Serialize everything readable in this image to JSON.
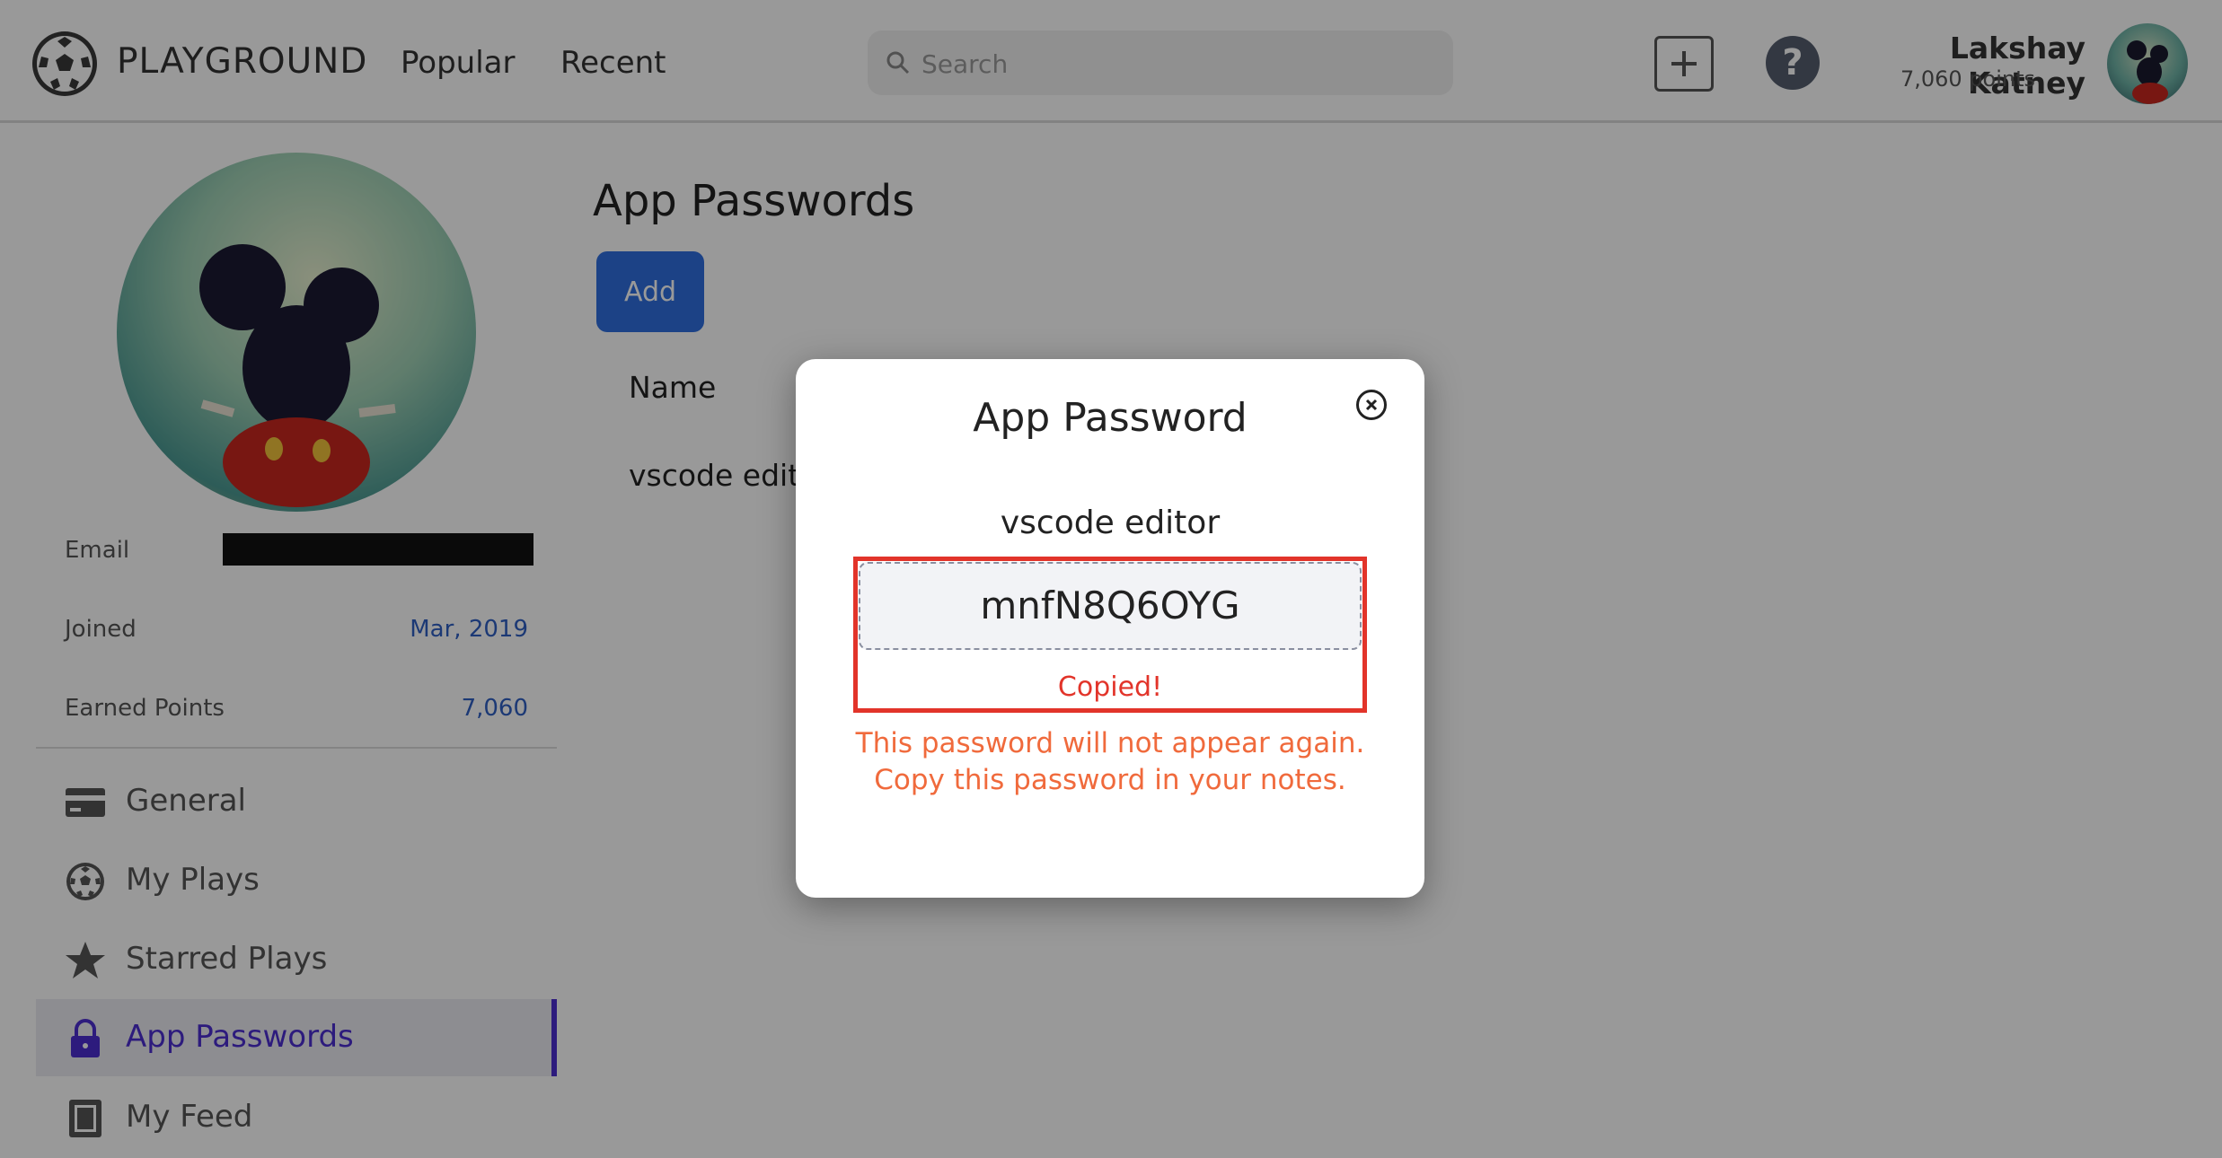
{
  "header": {
    "brand": "PLAYGROUND",
    "nav": [
      "Popular",
      "Recent"
    ],
    "search_placeholder": "Search",
    "help_glyph": "?",
    "user_name": "Lakshay Katney",
    "user_points": "7,060 points"
  },
  "profile": {
    "email_label": "Email",
    "joined_label": "Joined",
    "joined_value": "Mar, 2019",
    "points_label": "Earned Points",
    "points_value": "7,060"
  },
  "sidebar": {
    "items": [
      {
        "label": "General",
        "icon": "card-icon"
      },
      {
        "label": "My Plays",
        "icon": "soccer-ball-icon"
      },
      {
        "label": "Starred Plays",
        "icon": "star-icon"
      },
      {
        "label": "App Passwords",
        "icon": "lock-icon",
        "active": true
      },
      {
        "label": "My Feed",
        "icon": "feed-icon"
      }
    ]
  },
  "main": {
    "title": "App Passwords",
    "add_label": "Add",
    "column_name": "Name",
    "row_name": "vscode editor"
  },
  "modal": {
    "title": "App Password",
    "subtitle": "vscode editor",
    "password": "mnfN8Q6OYG",
    "copied": "Copied!",
    "warning_line1": "This password will not appear again.",
    "warning_line2": "Copy this password in your notes."
  },
  "colors": {
    "accent": "#4b2ed0",
    "primary_button": "#2f6fe0",
    "highlight": "#e2342a",
    "warning": "#f06a3c",
    "link": "#2f5fc4"
  }
}
